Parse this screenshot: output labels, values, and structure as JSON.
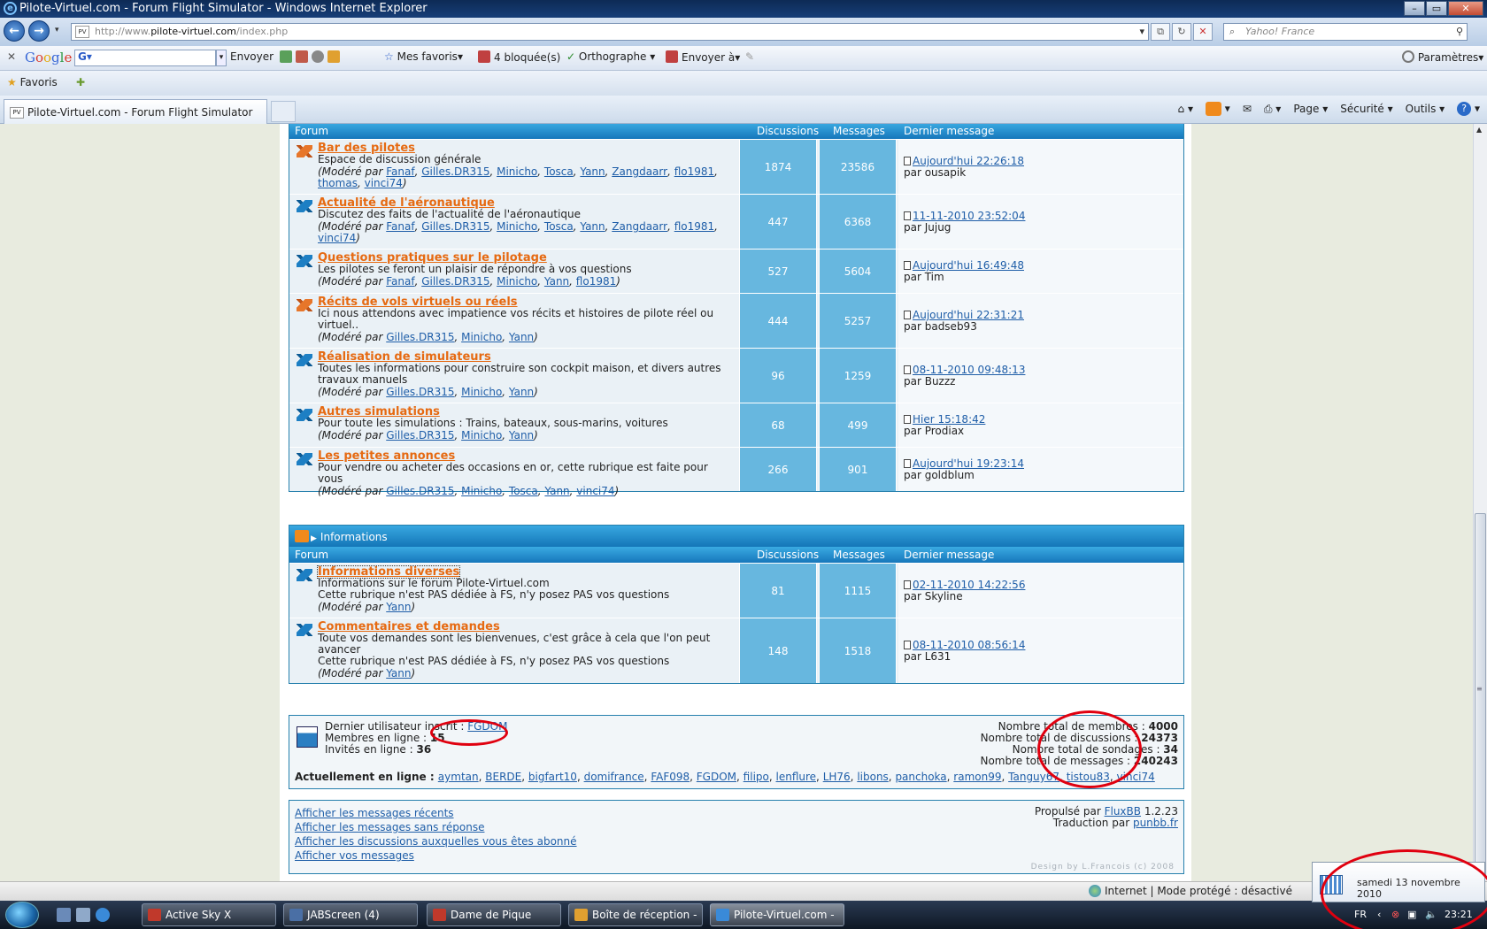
{
  "window": {
    "title": "Pilote-Virtuel.com - Forum Flight Simulator - Windows Internet Explorer"
  },
  "address": {
    "prefix": "http://www.",
    "domain": "pilote-virtuel.com",
    "path": "/index.php",
    "search_placeholder": "Yahoo! France"
  },
  "google_bar": {
    "logo": [
      "G",
      "o",
      "o",
      "g",
      "l",
      "e"
    ],
    "field": "G▾",
    "send": "Envoyer à▾",
    "search_send": "Envoyer",
    "favorites": "Mes favoris▾",
    "blocked": "4 bloquée(s)",
    "spelling": "Orthographe",
    "settings": "Paramètres▾"
  },
  "fav_bar": {
    "favorites": "Favoris"
  },
  "tab": {
    "label": "Pilote-Virtuel.com - Forum Flight Simulator"
  },
  "command_bar": {
    "page": "Page ▾",
    "security": "Sécurité ▾",
    "tools": "Outils ▾"
  },
  "section1": {
    "col_forum": "Forum",
    "col_discussions": "Discussions",
    "col_messages": "Messages",
    "col_last": "Dernier message",
    "forums": [
      {
        "icon": "orange",
        "title": "Bar des pilotes",
        "desc": "Espace de discussion générale",
        "mods": [
          "Fanaf",
          "Gilles.DR315",
          "Minicho",
          "Tosca",
          "Yann",
          "Zangdaarr",
          "flo1981",
          "thomas",
          "vinci74"
        ],
        "discussions": "1874",
        "messages": "23586",
        "last_date": "Aujourd'hui 22:26:18",
        "last_by": "par ousapik"
      },
      {
        "icon": "blue",
        "title": "Actualité de l'aéronautique",
        "desc": "Discutez des faits de l'actualité de l'aéronautique",
        "mods": [
          "Fanaf",
          "Gilles.DR315",
          "Minicho",
          "Tosca",
          "Yann",
          "Zangdaarr",
          "flo1981",
          "vinci74"
        ],
        "discussions": "447",
        "messages": "6368",
        "last_date": "11-11-2010 23:52:04",
        "last_by": "par Jujug"
      },
      {
        "icon": "blue",
        "title": "Questions pratiques sur le pilotage",
        "desc": "Les pilotes se feront un plaisir de répondre à vos questions",
        "mods": [
          "Fanaf",
          "Gilles.DR315",
          "Minicho",
          "Yann",
          "flo1981"
        ],
        "discussions": "527",
        "messages": "5604",
        "last_date": "Aujourd'hui 16:49:48",
        "last_by": "par Tim"
      },
      {
        "icon": "orange",
        "title": "Récits de vols virtuels ou réels",
        "desc": "Ici nous attendons avec impatience vos récits et histoires de pilote réel ou virtuel..",
        "mods": [
          "Gilles.DR315",
          "Minicho",
          "Yann"
        ],
        "discussions": "444",
        "messages": "5257",
        "last_date": "Aujourd'hui 22:31:21",
        "last_by": "par badseb93"
      },
      {
        "icon": "blue",
        "title": "Réalisation de simulateurs",
        "desc": "Toutes les informations pour construire son cockpit maison, et divers autres travaux manuels",
        "mods": [
          "Gilles.DR315",
          "Minicho",
          "Yann"
        ],
        "discussions": "96",
        "messages": "1259",
        "last_date": "08-11-2010 09:48:13",
        "last_by": "par Buzzz"
      },
      {
        "icon": "blue",
        "title": "Autres simulations",
        "desc": "Pour toute les simulations : Trains, bateaux, sous-marins, voitures",
        "mods": [
          "Gilles.DR315",
          "Minicho",
          "Yann"
        ],
        "discussions": "68",
        "messages": "499",
        "last_date": "Hier 15:18:42",
        "last_by": "par Prodiax"
      },
      {
        "icon": "blue",
        "title": "Les petites annonces",
        "desc": "Pour vendre ou acheter des occasions en or, cette rubrique est faite pour vous",
        "mods": [
          "Gilles.DR315",
          "Minicho",
          "Tosca",
          "Yann",
          "vinci74"
        ],
        "discussions": "266",
        "messages": "901",
        "last_date": "Aujourd'hui 19:23:14",
        "last_by": "par goldblum"
      }
    ]
  },
  "section2": {
    "title": "Informations",
    "col_forum": "Forum",
    "col_discussions": "Discussions",
    "col_messages": "Messages",
    "col_last": "Dernier message",
    "forums": [
      {
        "icon": "blue",
        "title": "Informations diverses",
        "desc": "Informations sur le forum Pilote-Virtuel.com",
        "desc2": "Cette rubrique n'est PAS dédiée à FS, n'y posez PAS vos questions",
        "mods": [
          "Yann"
        ],
        "discussions": "81",
        "messages": "1115",
        "last_date": "02-11-2010 14:22:56",
        "last_by": "par Skyline"
      },
      {
        "icon": "blue",
        "title": "Commentaires et demandes",
        "desc": "Toute vos demandes sont les bienvenues, c'est grâce à cela que l'on peut avancer",
        "desc2": "Cette rubrique n'est PAS dédiée à FS, n'y posez PAS vos questions",
        "mods": [
          "Yann"
        ],
        "discussions": "148",
        "messages": "1518",
        "last_date": "08-11-2010 08:56:14",
        "last_by": "par L631"
      }
    ]
  },
  "mods_prefix": "(Modéré par ",
  "mods_suffix": ")",
  "stats": {
    "last_user_label": "Dernier utilisateur inscrit : ",
    "last_user": "FGDOM",
    "members_online_label": "Membres en ligne : ",
    "members_online": "15",
    "guests_online_label": "Invités en ligne : ",
    "guests_online": "36",
    "total_members_label": "Nombre total de membres : ",
    "total_members": "4000",
    "total_discussions_label": "Nombre total de discussions : ",
    "total_discussions": "24373",
    "total_polls_label": "Nombre total de sondages : ",
    "total_polls": "34",
    "total_messages_label": "Nombre total de messages : ",
    "total_messages": "240243",
    "online_now_label": "Actuellement en ligne : ",
    "online_users": [
      "aymtan",
      "BERDE",
      "bigfart10",
      "domifrance",
      "FAF098",
      "FGDOM",
      "filipo",
      "lenflure",
      "LH76",
      "libons",
      "panchoka",
      "ramon99",
      "Tanguy67",
      "tistou83",
      "vinci74"
    ]
  },
  "footer": {
    "links": [
      "Afficher les messages récents",
      "Afficher les messages sans réponse",
      "Afficher les discussions auxquelles vous êtes abonné",
      "Afficher vos messages"
    ],
    "powered_label": "Propulsé par ",
    "powered_link": "FluxBB",
    "powered_version": " 1.2.23",
    "translation_label": "Traduction par ",
    "translation_link": "punbb.fr",
    "design": "Design by L.Francois (c) 2008"
  },
  "status": {
    "zone": "Internet | Mode protégé : désactivé"
  },
  "taskbar": {
    "buttons": [
      {
        "label": "Active Sky X",
        "color": "#c0392b"
      },
      {
        "label": "JABScreen (4)",
        "color": "#4a6fa5"
      },
      {
        "label": "Dame de Pique",
        "color": "#c0392b"
      },
      {
        "label": "Boîte de réception - ...",
        "color": "#e0a030"
      },
      {
        "label": "Pilote-Virtuel.com - ...",
        "color": "#3a8ad8"
      }
    ],
    "lang": "FR",
    "time": "23:21"
  },
  "date_tooltip": "samedi 13 novembre 2010",
  "colors": {
    "accent": "#1476b8",
    "forum_title": "#e66a12",
    "count_cell": "#67b7df",
    "annotation_ring": "#e0000f"
  }
}
